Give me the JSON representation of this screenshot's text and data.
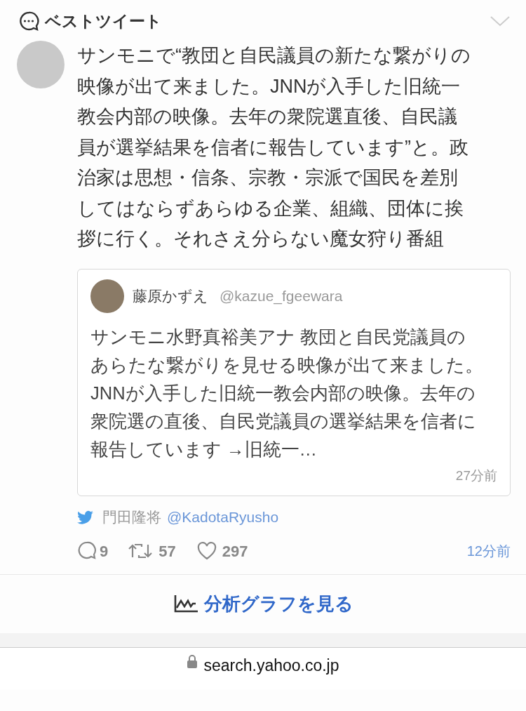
{
  "section": {
    "title": "ベストツイート"
  },
  "tweet": {
    "text": "サンモニで“教団と自民議員の新たな繋がりの映像が出て来ました。JNNが入手した旧統一教会内部の映像。去年の衆院選直後、自民議員が選挙結果を信者に報告しています”と。政治家は思想・信条、宗教・宗派で国民を差別してはならずあらゆる企業、組織、団体に挨拶に行く。それさえ分らない魔女狩り番組",
    "quote": {
      "name": "藤原かずえ",
      "handle": "@kazue_fgeewara",
      "text": "サンモニ水野真裕美アナ 教団と自民党議員のあらたな繋がりを見せる映像が出て来ました。JNNが入手した旧統一教会内部の映像。去年の衆院選の直後、自民党議員の選挙結果を信者に報告しています →旧統一…",
      "time": "27分前"
    },
    "author": {
      "name": "門田隆将",
      "handle": "@KadotaRyusho"
    },
    "replies": "9",
    "retweets": "57",
    "likes": "297",
    "time": "12分前"
  },
  "analysis_link": "分析グラフを見る",
  "url_bar": {
    "url": "search.yahoo.co.jp"
  }
}
